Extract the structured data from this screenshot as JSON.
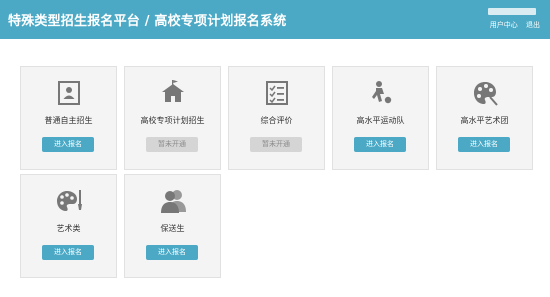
{
  "header": {
    "title": "特殊类型招生报名平台 / 高校专项计划报名系统",
    "links": [
      "用户中心",
      "退出"
    ]
  },
  "cards": [
    {
      "label": "普通自主招生",
      "button": "进入报名",
      "status": "active",
      "icon": "id-card-icon"
    },
    {
      "label": "高校专项计划招生",
      "button": "暂未开通",
      "status": "disabled",
      "icon": "school-icon"
    },
    {
      "label": "综合评价",
      "button": "暂未开通",
      "status": "disabled",
      "icon": "checklist-icon"
    },
    {
      "label": "高水平运动队",
      "button": "进入报名",
      "status": "active",
      "icon": "soccer-player-icon"
    },
    {
      "label": "高水平艺术团",
      "button": "进入报名",
      "status": "active",
      "icon": "palette-icon"
    },
    {
      "label": "艺术类",
      "button": "进入报名",
      "status": "active",
      "icon": "palette-brush-icon"
    },
    {
      "label": "保送生",
      "button": "进入报名",
      "status": "active",
      "icon": "users-icon"
    }
  ]
}
